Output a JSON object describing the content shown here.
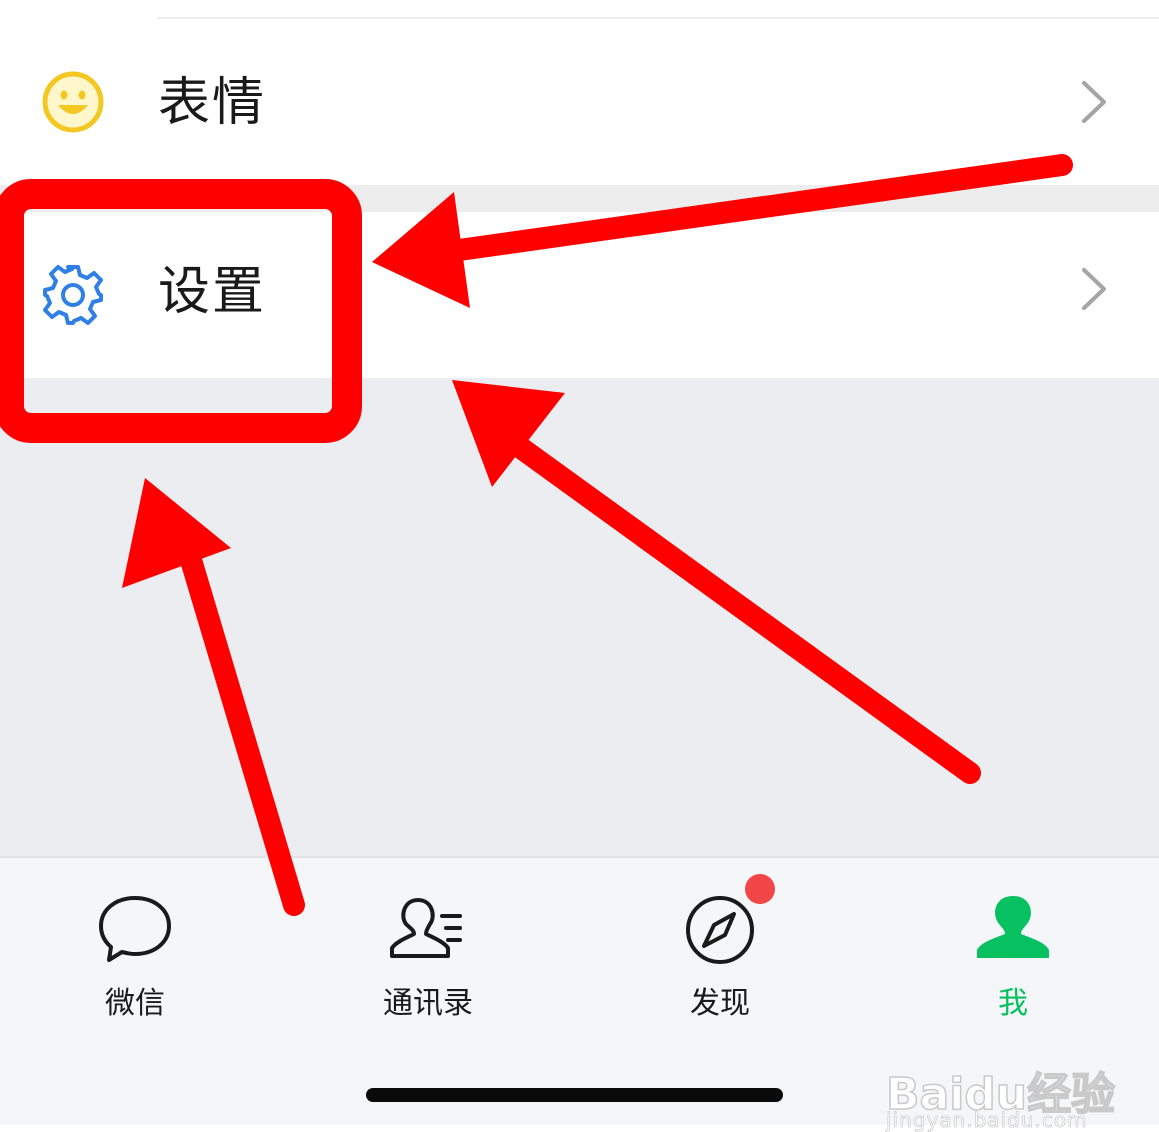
{
  "menu": {
    "items": [
      {
        "label": "表情",
        "icon": "smiley-icon"
      },
      {
        "label": "设置",
        "icon": "gear-icon"
      }
    ]
  },
  "tabbar": {
    "tabs": [
      {
        "label": "微信",
        "icon": "chat-bubble-icon",
        "active": false
      },
      {
        "label": "通讯录",
        "icon": "contacts-icon",
        "active": false
      },
      {
        "label": "发现",
        "icon": "compass-icon",
        "active": false,
        "badge": true
      },
      {
        "label": "我",
        "icon": "person-icon",
        "active": true
      }
    ]
  },
  "watermark": {
    "logo": "Baidu经验",
    "url": "jingyan.baidu.com"
  },
  "colors": {
    "active_tab": "#07c160",
    "badge": "#f04646",
    "gear_icon": "#2f7fe6",
    "smiley_icon": "#f4c823",
    "annotation": "#ff0000"
  }
}
